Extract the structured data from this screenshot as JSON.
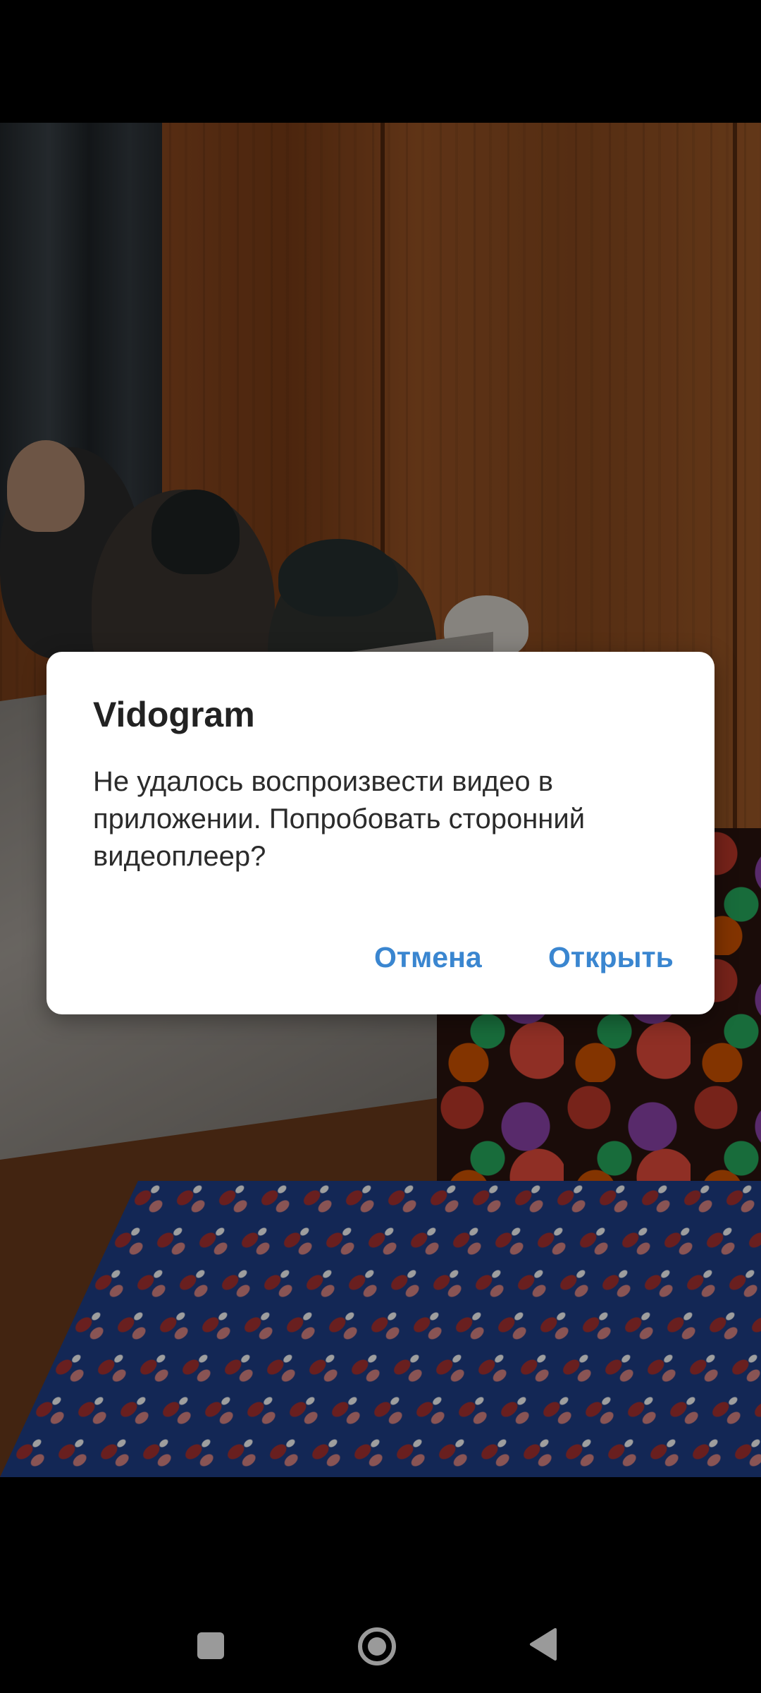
{
  "dialog": {
    "title": "Vidogram",
    "message": "Не удалось воспроизвести видео в приложении. Попробовать сторонний видеоплеер?",
    "cancel_label": "Отмена",
    "open_label": "Открыть"
  },
  "colors": {
    "accent": "#3a86d0",
    "dialog_background": "#ffffff",
    "title_text": "#222222",
    "body_text": "#2b2b2b",
    "system_bars": "#000000",
    "nav_icons": "#9a9a9a"
  },
  "navigation": {
    "recents_icon": "square-recents-icon",
    "home_icon": "circle-home-icon",
    "back_icon": "triangle-back-icon"
  }
}
